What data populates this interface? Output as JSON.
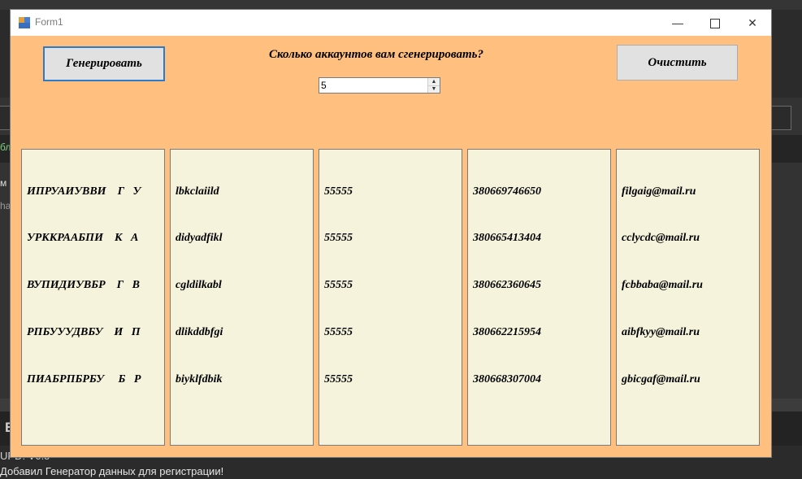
{
  "window": {
    "title": "Form1",
    "minimize_glyph": "—",
    "close_glyph": "✕"
  },
  "controls": {
    "generate_label": "Генерировать",
    "clear_label": "Очистить",
    "question": "Сколько аккаунтов вам сгенерировать?",
    "count_value": "5"
  },
  "lists": {
    "names": [
      "ИПРУАИУВВИ    Г   У",
      "УРККРААБПИ    К   А",
      "ВУПИДИУВБР    Г   В",
      "РПБУУУДВБУ    И   П",
      "ПИАБРПБРБУ     Б   Р"
    ],
    "logins": [
      "lbkclaiild",
      "didyadfikl",
      "cgldilkabl",
      "dlikddbfgi",
      "biyklfdbik"
    ],
    "passwords": [
      "55555",
      "55555",
      "55555",
      "55555",
      "55555"
    ],
    "phones": [
      "380669746650",
      "380665413404",
      "380662360645",
      "380662215954",
      "380668307004"
    ],
    "emails": [
      "filgaig@mail.ru",
      "cclycdc@mail.ru",
      "fcbbaba@mail.ru",
      "aibfkyy@mail.ru",
      "gbicgaf@mail.ru"
    ]
  },
  "background": {
    "side_text_1": "м",
    "side_text_2": "ha",
    "green_text": "бл",
    "bottom_letter": "Е",
    "version_text": "UPD! V0.5",
    "note_text": "Добавил Генератор данных для регистрации!"
  }
}
